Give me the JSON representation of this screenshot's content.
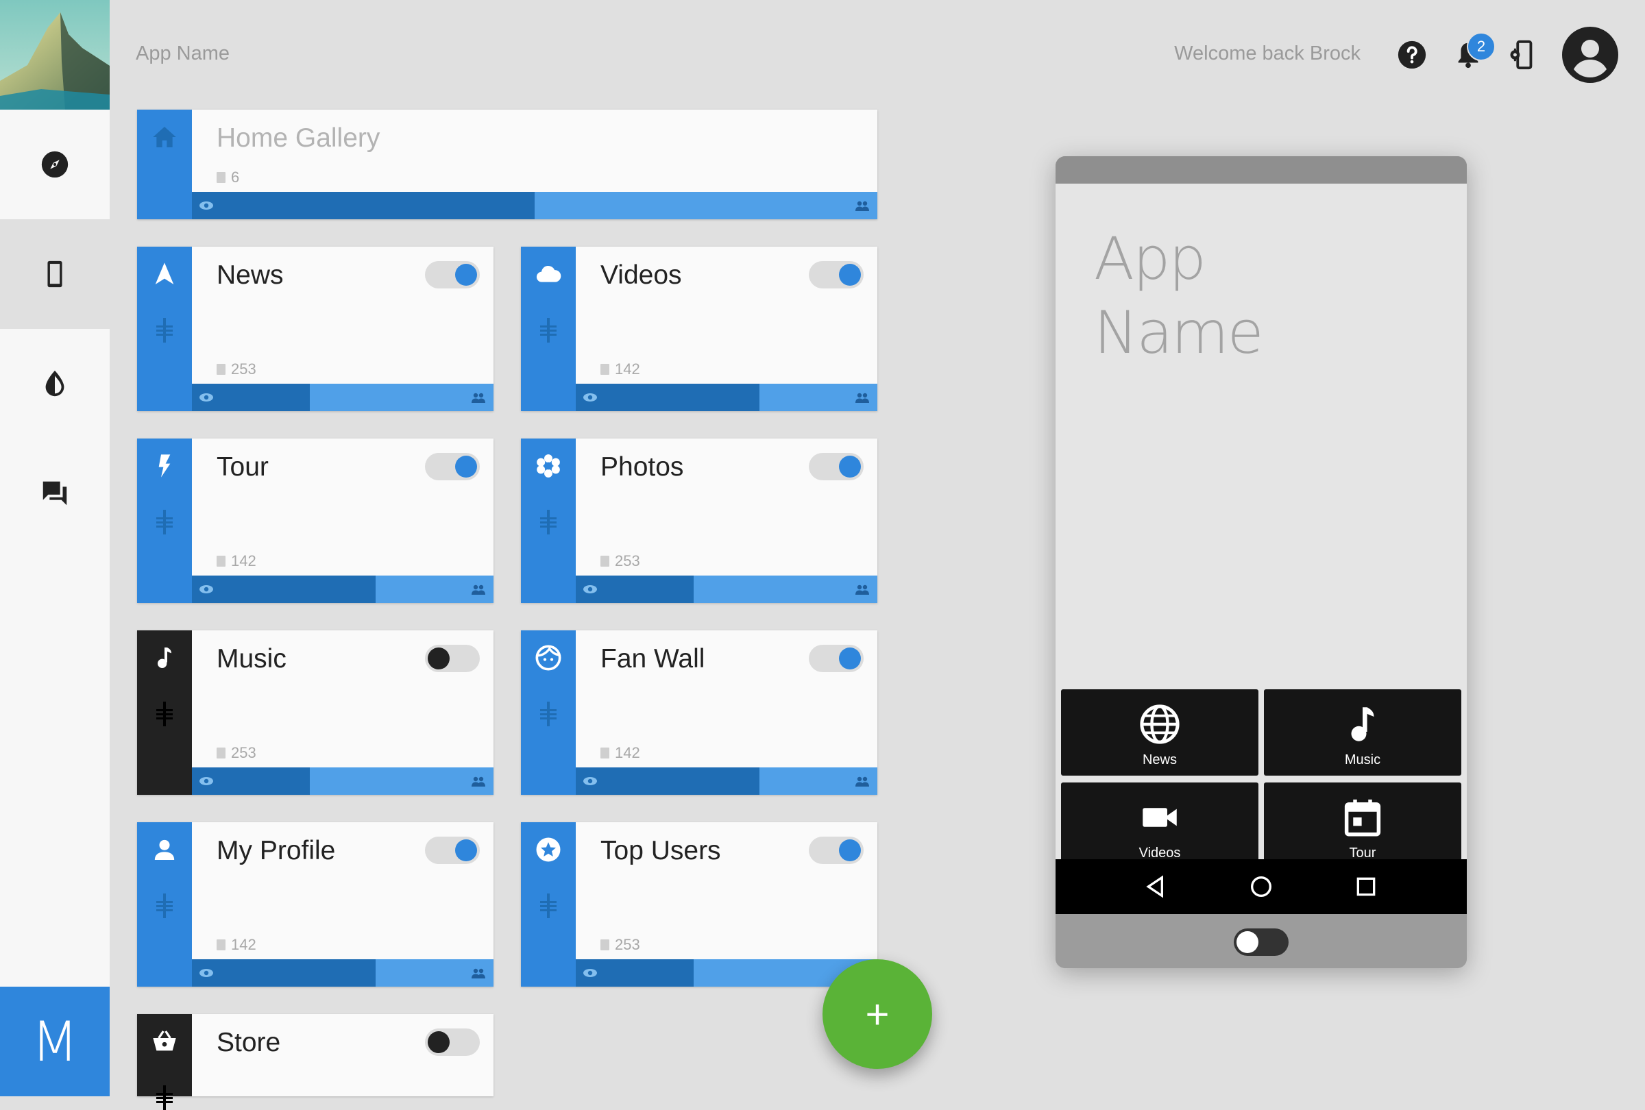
{
  "header": {
    "app_name": "App Name",
    "welcome": "Welcome back Brock",
    "notification_count": "2",
    "icons": [
      "help-icon",
      "bell-icon",
      "device-settings-icon",
      "account-icon"
    ]
  },
  "sidebar": {
    "items": [
      {
        "icon": "compass-icon",
        "active": false
      },
      {
        "icon": "phone-icon",
        "active": true
      },
      {
        "icon": "theme-drop-icon",
        "active": false
      },
      {
        "icon": "chat-icon",
        "active": false
      }
    ],
    "brand_letter": "M"
  },
  "home_gallery": {
    "title": "Home Gallery",
    "count": "6",
    "progress": 0.5
  },
  "cards": [
    {
      "title": "News",
      "count": "253",
      "enabled": true,
      "icon": "navigation-arrow-icon",
      "progress": 0.39
    },
    {
      "title": "Videos",
      "count": "142",
      "enabled": true,
      "icon": "cloud-icon",
      "progress": 0.61
    },
    {
      "title": "Tour",
      "count": "142",
      "enabled": true,
      "icon": "flash-icon",
      "progress": 0.61
    },
    {
      "title": "Photos",
      "count": "253",
      "enabled": true,
      "icon": "flower-icon",
      "progress": 0.39
    },
    {
      "title": "Music",
      "count": "253",
      "enabled": false,
      "icon": "music-note-icon",
      "progress": 0.39
    },
    {
      "title": "Fan Wall",
      "count": "142",
      "enabled": true,
      "icon": "face-icon",
      "progress": 0.61
    },
    {
      "title": "My Profile",
      "count": "142",
      "enabled": true,
      "icon": "person-icon",
      "progress": 0.61
    },
    {
      "title": "Top Users",
      "count": "253",
      "enabled": true,
      "icon": "star-circle-icon",
      "progress": 0.39
    },
    {
      "title": "Store",
      "count": "",
      "enabled": false,
      "icon": "basket-icon",
      "progress": 0
    }
  ],
  "fab": {
    "label": "+"
  },
  "preview": {
    "app_name_line1": "App",
    "app_name_line2": "Name",
    "tiles": [
      {
        "label": "News",
        "icon": "globe-icon"
      },
      {
        "label": "Music",
        "icon": "music-note-icon"
      },
      {
        "label": "Videos",
        "icon": "videocam-icon"
      },
      {
        "label": "Tour",
        "icon": "calendar-icon"
      }
    ],
    "nav_buttons": [
      "back-icon",
      "home-icon",
      "recents-icon"
    ]
  },
  "colors": {
    "accent": "#2f86dc",
    "bar_fill": "#1f6db4",
    "bar_track": "#50a0e8",
    "fab": "#5ab337",
    "dark_strip": "#222222"
  }
}
